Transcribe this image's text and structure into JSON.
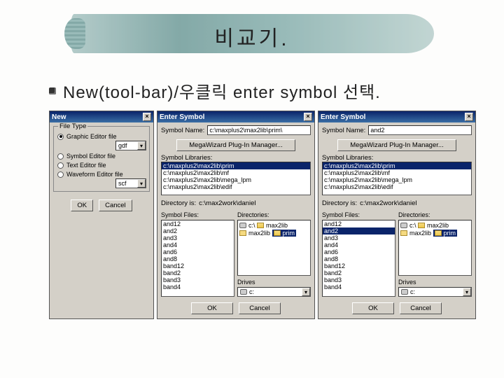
{
  "slide": {
    "title": "비교기.",
    "bullet": "New(tool-bar)/우클릭 enter symbol 선택."
  },
  "new_dialog": {
    "title": "New",
    "group_label": "File Type",
    "radios": [
      {
        "label": "Graphic Editor file",
        "selected": true
      },
      {
        "label": "Symbol Editor file",
        "selected": false
      },
      {
        "label": "Text Editor file",
        "selected": false
      },
      {
        "label": "Waveform Editor file",
        "selected": false
      }
    ],
    "ext1": "gdf",
    "ext2": "scf",
    "ok": "OK",
    "cancel": "Cancel"
  },
  "enter_symbol_common": {
    "title": "Enter Symbol",
    "symbol_name_label": "Symbol Name:",
    "mega_button": "MegaWizard Plug-In Manager...",
    "libs_label": "Symbol Libraries:",
    "dir_is_label": "Directory is:",
    "dir_is_value": "c:\\max2work\\daniel",
    "symbol_files_label": "Symbol Files:",
    "directories_label": "Directories:",
    "drives_label": "Drives",
    "drive_value": "c:",
    "ok": "OK",
    "cancel": "Cancel",
    "libs": [
      "c:\\maxplus2\\max2lib\\prim",
      "c:\\maxplus2\\max2lib\\mf",
      "c:\\maxplus2\\max2lib\\mega_lpm",
      "c:\\maxplus2\\max2lib\\edif"
    ],
    "symbol_files": [
      "and12",
      "and2",
      "and3",
      "and4",
      "and6",
      "and8",
      "band12",
      "band2",
      "band3",
      "band4"
    ],
    "directories": [
      {
        "name": "c:\\",
        "type": "drive"
      },
      {
        "name": "max2lib",
        "type": "folder-open"
      },
      {
        "name": "max2lib",
        "type": "folder"
      },
      {
        "name": "prim",
        "type": "folder-open-sel"
      }
    ]
  },
  "dlg1": {
    "symbol_name_value": "c:\\maxplus2\\max2lib\\prim\\",
    "files_selected_index": -1
  },
  "dlg2": {
    "symbol_name_value": "and2",
    "files_selected_index": 1
  }
}
